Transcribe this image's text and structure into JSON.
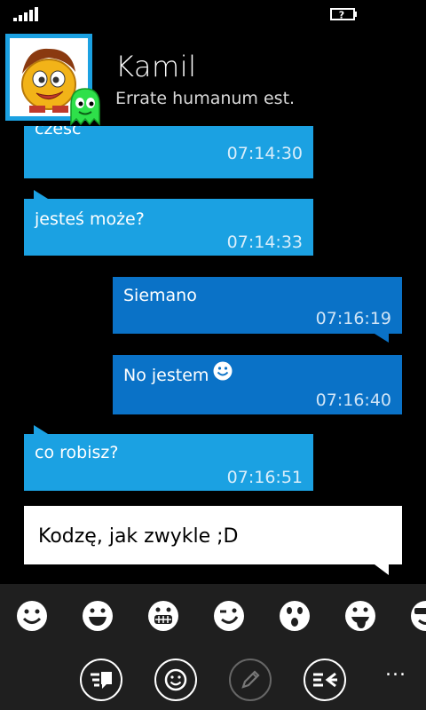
{
  "contact": {
    "name": "Kamil",
    "status": "Errate humanum est."
  },
  "messages": [
    {
      "direction": "in",
      "text": "cześć",
      "time": "07:14:30"
    },
    {
      "direction": "in",
      "text": "jesteś może?",
      "time": "07:14:33"
    },
    {
      "direction": "out",
      "text": "Siemano",
      "time": "07:16:19"
    },
    {
      "direction": "out",
      "text": "No jestem",
      "time": "07:16:40",
      "icon": "smiley-icon"
    },
    {
      "direction": "in",
      "text": "co robisz?",
      "time": "07:16:51"
    }
  ],
  "composer": {
    "draft_text": "Kodzę, jak zwykle ;D"
  },
  "emoji_bar": [
    "smile-icon",
    "grin-icon",
    "big-grin-icon",
    "wink-icon",
    "surprised-icon",
    "tongue-icon",
    "cool-icon"
  ],
  "appbar": {
    "more": "...",
    "buttons": [
      "send-icon",
      "emoticons-icon",
      "edit-icon",
      "back-icon"
    ]
  },
  "colors": {
    "incoming": "#1ba1e2",
    "outgoing": "#0a72c7",
    "draft": "#ffffff",
    "appbar": "#1f1f1f"
  }
}
